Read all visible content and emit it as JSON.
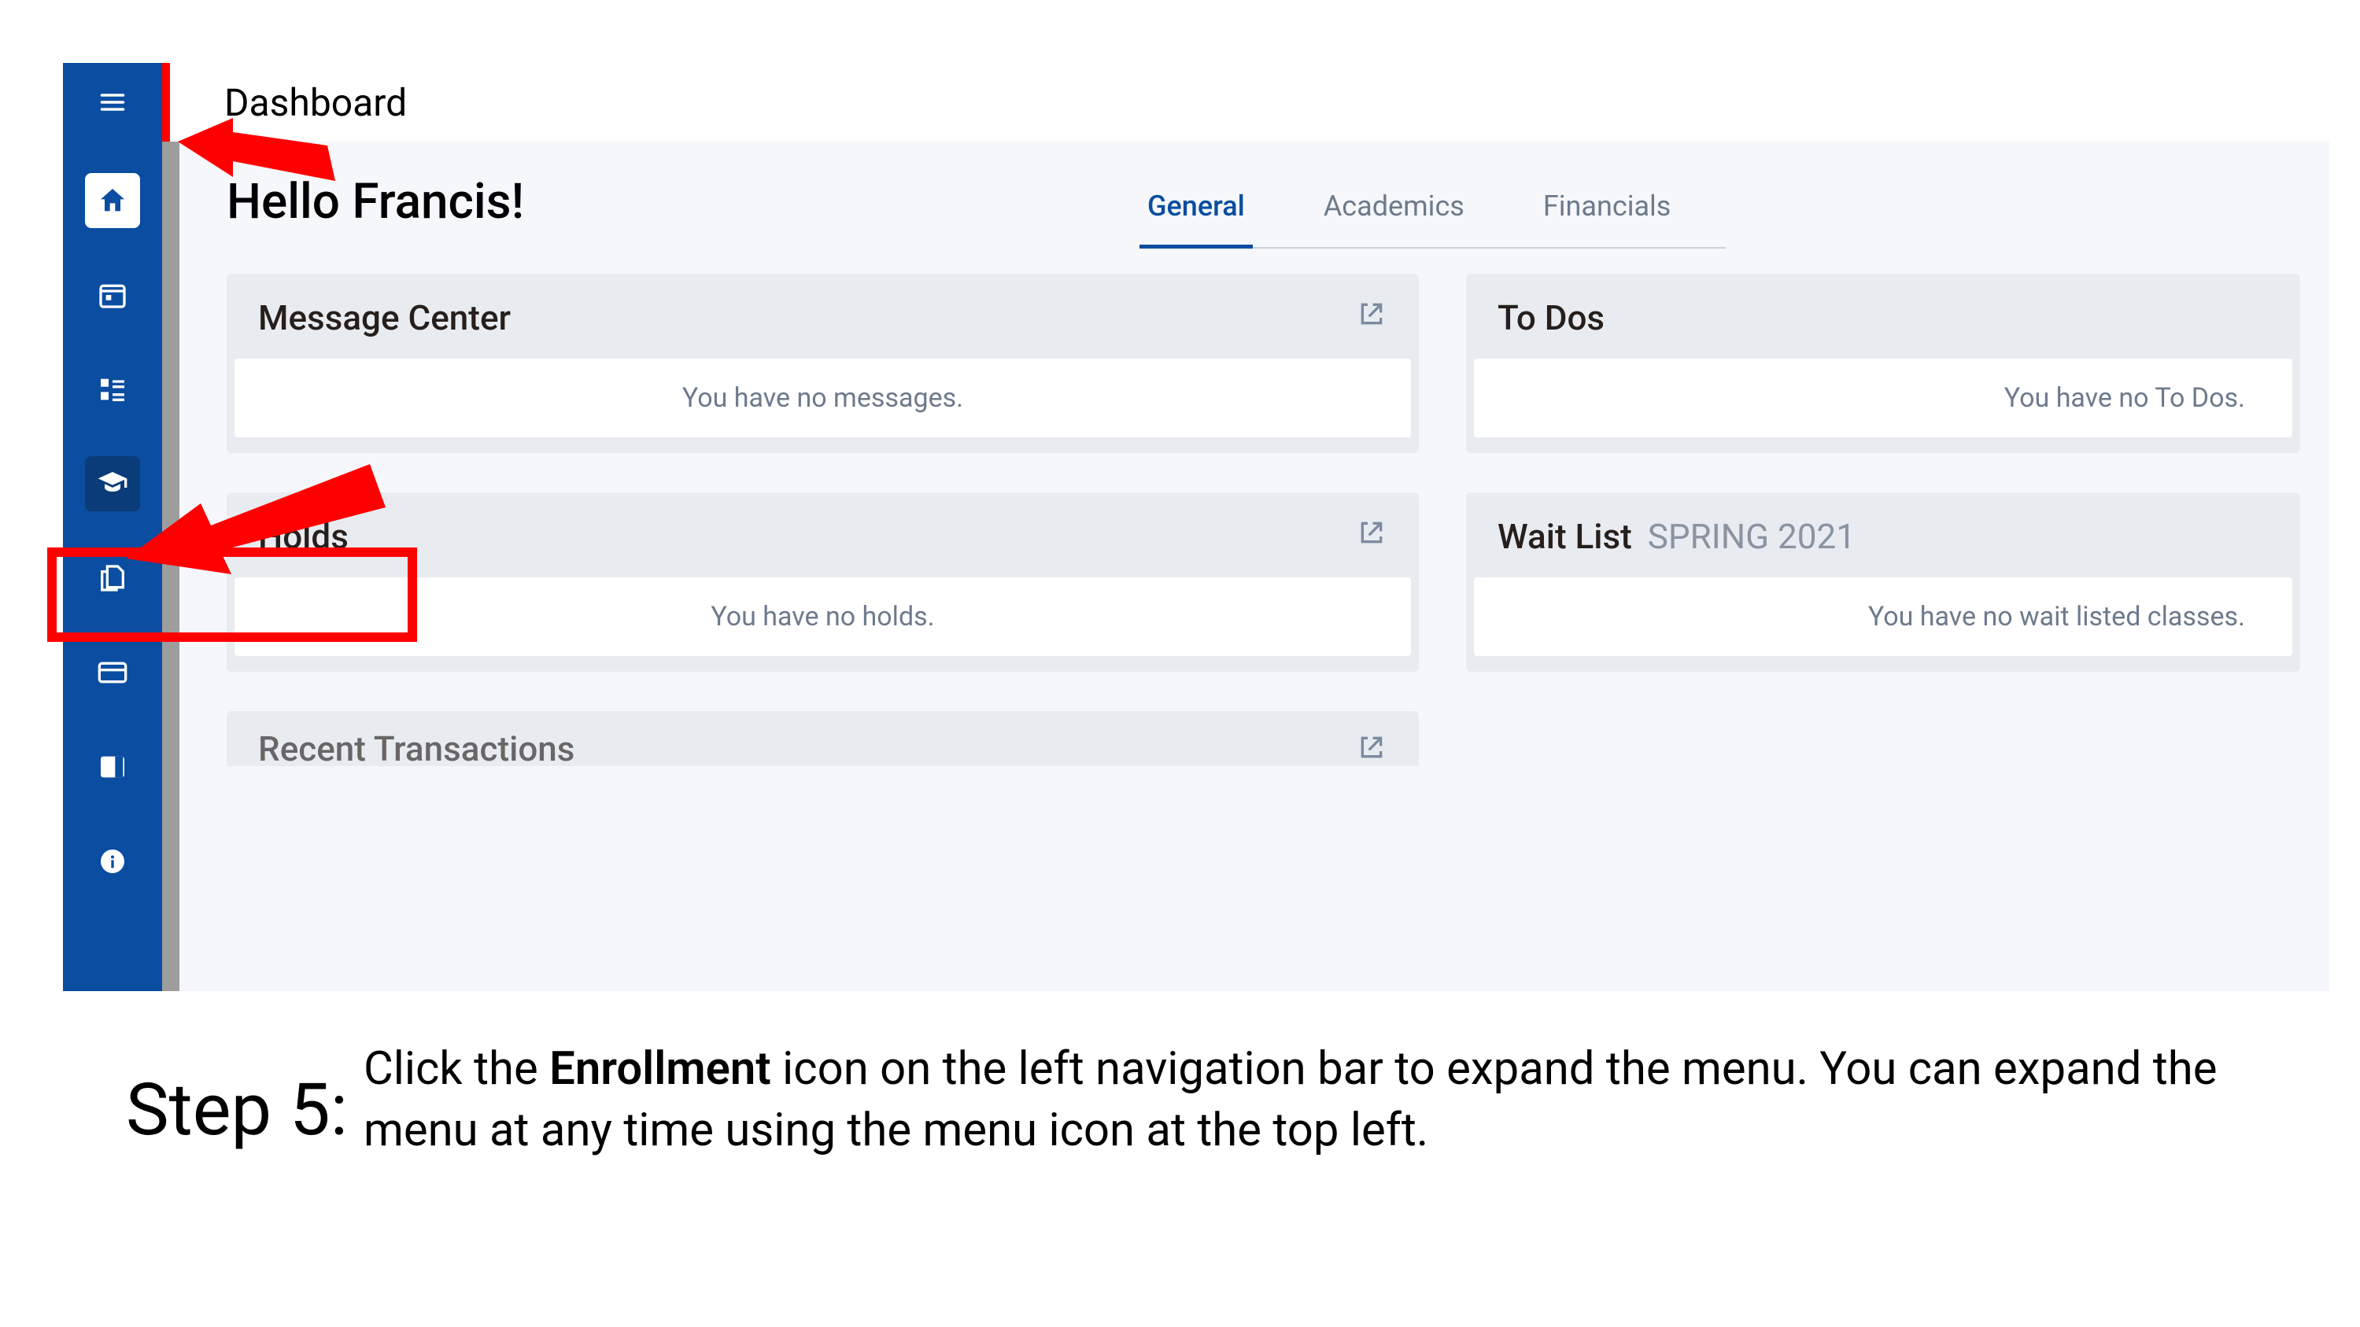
{
  "page_title": "Dashboard",
  "greeting": "Hello Francis!",
  "tabs": {
    "general": "General",
    "academics": "Academics",
    "financials": "Financials"
  },
  "tooltip": {
    "enrollment": "Enrollment"
  },
  "cards": {
    "message_center": {
      "title": "Message Center",
      "empty": "You have no messages."
    },
    "todos": {
      "title": "To Dos",
      "empty": "You have no To Dos."
    },
    "holds": {
      "title": "Holds",
      "empty": "You have no holds."
    },
    "waitlist": {
      "title": "Wait List",
      "term": "SPRING 2021",
      "empty": "You have no wait listed classes."
    },
    "recent_tx": {
      "title": "Recent Transactions"
    }
  },
  "instruction": {
    "step_label": "Step 5:",
    "pre": "Click the ",
    "bold": "Enrollment",
    "post": " icon on the left navigation bar to expand the menu. You can expand the menu at any time using the menu icon at the top left."
  }
}
